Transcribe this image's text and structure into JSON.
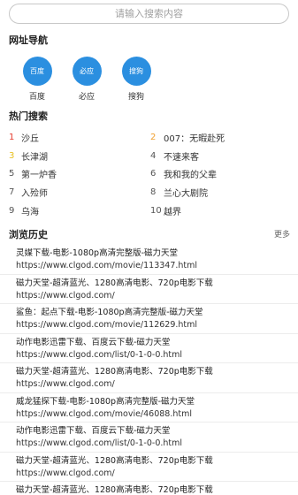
{
  "search": {
    "placeholder": "请输入搜索内容"
  },
  "nav": {
    "title": "网址导航",
    "items": [
      {
        "icon_text": "百度",
        "label": "百度"
      },
      {
        "icon_text": "必应",
        "label": "必应"
      },
      {
        "icon_text": "搜狗",
        "label": "搜狗"
      }
    ]
  },
  "hot": {
    "title": "热门搜索",
    "items": [
      {
        "rank": "1",
        "text": "沙丘",
        "color": "#e63b2e"
      },
      {
        "rank": "2",
        "text": "007：无暇赴死",
        "color": "#f0a030"
      },
      {
        "rank": "3",
        "text": "长津湖",
        "color": "#e8c020"
      },
      {
        "rank": "4",
        "text": "不速来客",
        "color": "#555555"
      },
      {
        "rank": "5",
        "text": "第一炉香",
        "color": "#555555"
      },
      {
        "rank": "6",
        "text": "我和我的父辈",
        "color": "#555555"
      },
      {
        "rank": "7",
        "text": "入殓师",
        "color": "#555555"
      },
      {
        "rank": "8",
        "text": "兰心大剧院",
        "color": "#555555"
      },
      {
        "rank": "9",
        "text": "乌海",
        "color": "#555555"
      },
      {
        "rank": "10",
        "text": "越界",
        "color": "#555555"
      }
    ]
  },
  "history": {
    "title": "浏览历史",
    "more_label": "更多",
    "items": [
      {
        "title": "灵媒下载-电影-1080p高清完整版-磁力天堂",
        "url": "https://www.clgod.com/movie/113347.html"
      },
      {
        "title": "磁力天堂-超清蓝光、1280高清电影、720p电影下载",
        "url": "https://www.clgod.com/"
      },
      {
        "title": "鲨鱼：起点下载-电影-1080p高清完整版-磁力天堂",
        "url": "https://www.clgod.com/movie/112629.html"
      },
      {
        "title": "动作电影迅雷下载、百度云下载-磁力天堂",
        "url": "https://www.clgod.com/list/0-1-0-0.html"
      },
      {
        "title": "磁力天堂-超清蓝光、1280高清电影、720p电影下载",
        "url": "https://www.clgod.com/"
      },
      {
        "title": "威龙猛探下载-电影-1080p高清完整版-磁力天堂",
        "url": "https://www.clgod.com/movie/46088.html"
      },
      {
        "title": "动作电影迅雷下载、百度云下载-磁力天堂",
        "url": "https://www.clgod.com/list/0-1-0-0.html"
      },
      {
        "title": "磁力天堂-超清蓝光、1280高清电影、720p电影下载",
        "url": "https://www.clgod.com/"
      },
      {
        "title": "磁力天堂-超清蓝光、1280高清电影、720p电影下载",
        "url": ""
      }
    ]
  },
  "colors": {
    "accent": "#2b8fe0"
  }
}
